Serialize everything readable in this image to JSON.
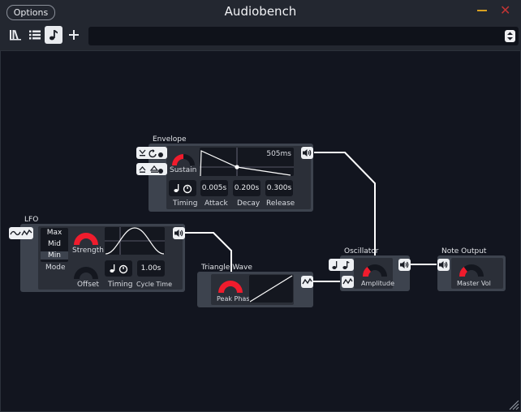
{
  "app": {
    "title": "Audiobench",
    "options_label": "Options"
  },
  "toolbar": {
    "buttons": [
      "library-icon",
      "list-icon",
      "music-note-icon",
      "plus-icon"
    ],
    "active": "music-note-icon",
    "patch_name": ""
  },
  "modules": {
    "envelope": {
      "title": "Envelope",
      "knob": "Sustain",
      "graph_readout": "505ms",
      "timing": "Timing",
      "attack_value": "0.005s",
      "attack_label": "Attack",
      "decay_value": "0.200s",
      "decay_label": "Decay",
      "release_value": "0.300s",
      "release_label": "Release",
      "sustain_level": 0.5
    },
    "lfo": {
      "title": "LFO",
      "mode_options": [
        "Max",
        "Mid",
        "Min"
      ],
      "mode_selected": "Min",
      "mode_label": "Mode",
      "strength_label": "Strength",
      "offset_label": "Offset",
      "timing_label": "Timing",
      "cycle_value": "1.00s",
      "cycle_label": "Cycle Time",
      "strength_level": 1.0
    },
    "triangle": {
      "title": "Triangle Wave",
      "knob": "Peak Phase",
      "peak_level": 1.0
    },
    "oscillator": {
      "title": "Oscillator",
      "knob": "Amplitude",
      "amplitude_level": 0.35
    },
    "output": {
      "title": "Note Output",
      "knob": "Master Vol",
      "volume_level": 0.35
    }
  },
  "colors": {
    "accent": "#f01c2d",
    "canvas": "#12151f",
    "module": "#3d434e",
    "wire": "#ffffff"
  }
}
